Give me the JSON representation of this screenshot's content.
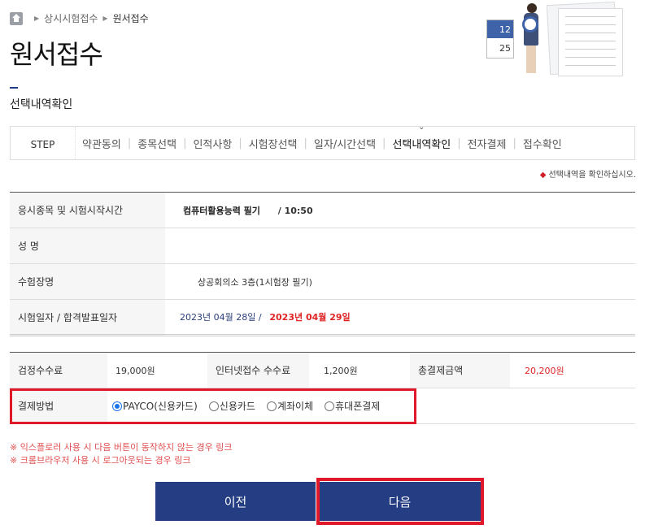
{
  "breadcrumb": {
    "items": [
      "상시시험접수",
      "원서접수"
    ]
  },
  "page_title": "원서접수",
  "illustration": {
    "calendar_top": "12",
    "calendar_bottom": "25"
  },
  "section_title": "선택내역확인",
  "steps": {
    "label": "STEP",
    "items": [
      "약관동의",
      "종목선택",
      "인적사항",
      "시험장선택",
      "일자/시간선택",
      "선택내역확인",
      "전자결제",
      "접수확인"
    ],
    "active": "선택내역확인"
  },
  "notice": "선택내역을 확인하십시오.",
  "info": {
    "rows": [
      {
        "label": "응시종목 및 시험시작시간",
        "subject": "컴퓨터활용능력 필기",
        "time": "/ 10:50"
      },
      {
        "label": "성 명",
        "value": ""
      },
      {
        "label": "수험장명",
        "value": "상공회의소 3층(1시험장 필기)"
      },
      {
        "label": "시험일자 / 합격발표일자",
        "exam_date": "2023년 04월 28일  /",
        "result_date": "2023년 04월 29일"
      }
    ]
  },
  "fees": {
    "exam_fee_label": "검정수수료",
    "exam_fee": "19,000원",
    "online_fee_label": "인터넷접수 수수료",
    "online_fee": "1,200원",
    "total_label": "총결제금액",
    "total": "20,200원"
  },
  "payment": {
    "label": "결제방법",
    "options": [
      "PAYCO(신용카드)",
      "신용카드",
      "계좌이체",
      "휴대폰결제"
    ],
    "selected": "PAYCO(신용카드)"
  },
  "warnings": [
    "※ 익스플로러 사용 시 다음 버튼이 동작하지 않는 경우 링크",
    "※ 크롬브라우저 사용 시 로그아웃되는 경우 링크"
  ],
  "buttons": {
    "prev": "이전",
    "next": "다음"
  },
  "colors": {
    "button_bg": "#253d82",
    "highlight": "#e0192a",
    "accent_red": "#e02424"
  }
}
